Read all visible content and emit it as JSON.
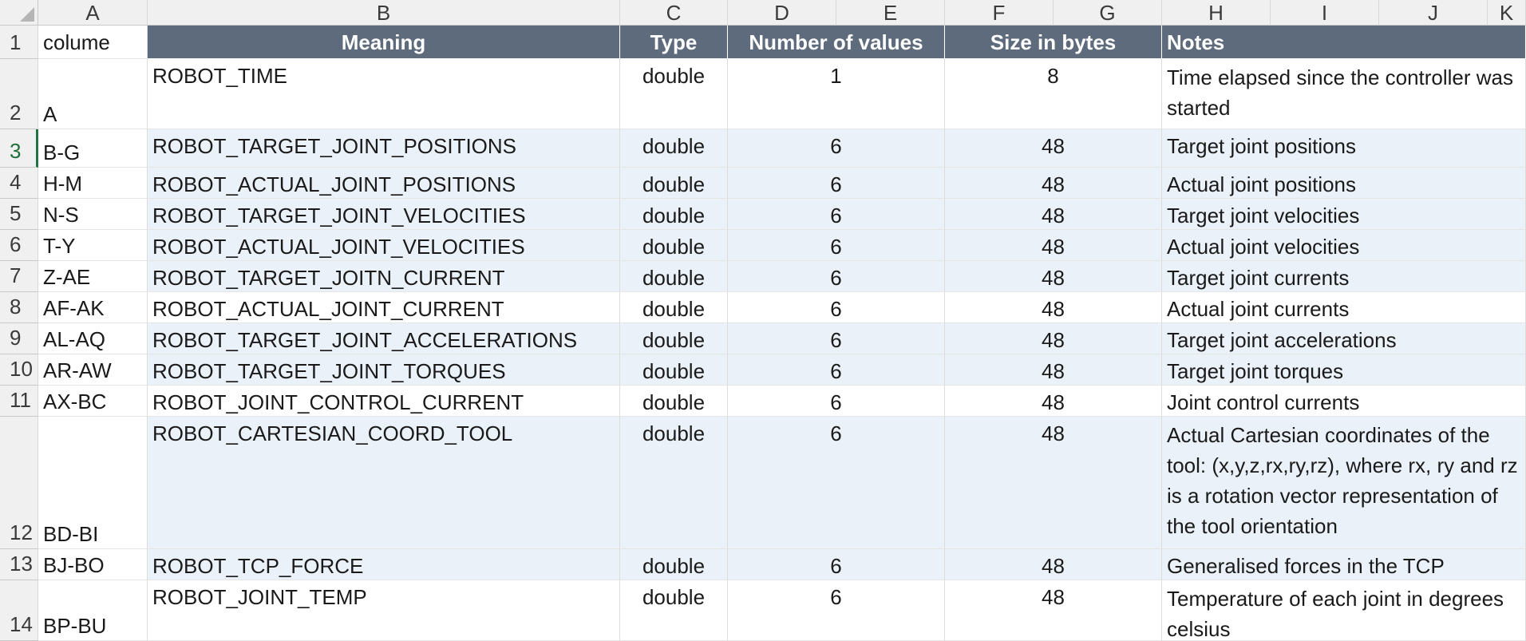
{
  "columns": [
    "A",
    "B",
    "C",
    "D",
    "E",
    "F",
    "G",
    "H",
    "I",
    "J",
    "K"
  ],
  "header": {
    "a": "colume",
    "meaning": "Meaning",
    "type": "Type",
    "count": "Number of values",
    "size": "Size in bytes",
    "notes": "Notes"
  },
  "rows": [
    {
      "num": "2",
      "col": "A",
      "meaning": "ROBOT_TIME",
      "type": "double",
      "count": "1",
      "size": "8",
      "notes": "Time elapsed since the controller was started"
    },
    {
      "num": "3",
      "col": "B-G",
      "meaning": "ROBOT_TARGET_JOINT_POSITIONS",
      "type": "double",
      "count": "6",
      "size": "48",
      "notes": "Target joint positions"
    },
    {
      "num": "4",
      "col": "H-M",
      "meaning": "ROBOT_ACTUAL_JOINT_POSITIONS",
      "type": "double",
      "count": "6",
      "size": "48",
      "notes": "Actual joint positions"
    },
    {
      "num": "5",
      "col": "N-S",
      "meaning": "ROBOT_TARGET_JOINT_VELOCITIES",
      "type": "double",
      "count": "6",
      "size": "48",
      "notes": "Target joint velocities"
    },
    {
      "num": "6",
      "col": "T-Y",
      "meaning": "ROBOT_ACTUAL_JOINT_VELOCITIES",
      "type": "double",
      "count": "6",
      "size": "48",
      "notes": "Actual joint velocities"
    },
    {
      "num": "7",
      "col": "Z-AE",
      "meaning": "ROBOT_TARGET_JOITN_CURRENT",
      "type": "double",
      "count": "6",
      "size": "48",
      "notes": "Target joint currents"
    },
    {
      "num": "8",
      "col": "AF-AK",
      "meaning": "ROBOT_ACTUAL_JOINT_CURRENT",
      "type": "double",
      "count": "6",
      "size": "48",
      "notes": "Actual joint currents"
    },
    {
      "num": "9",
      "col": "AL-AQ",
      "meaning": "ROBOT_TARGET_JOINT_ACCELERATIONS",
      "type": "double",
      "count": "6",
      "size": "48",
      "notes": "Target joint accelerations"
    },
    {
      "num": "10",
      "col": "AR-AW",
      "meaning": "ROBOT_TARGET_JOINT_TORQUES",
      "type": "double",
      "count": "6",
      "size": "48",
      "notes": "Target joint torques"
    },
    {
      "num": "11",
      "col": "AX-BC",
      "meaning": "ROBOT_JOINT_CONTROL_CURRENT",
      "type": "double",
      "count": "6",
      "size": "48",
      "notes": "Joint control currents"
    },
    {
      "num": "12",
      "col": "BD-BI",
      "meaning": "ROBOT_CARTESIAN_COORD_TOOL",
      "type": "double",
      "count": "6",
      "size": "48",
      "notes": "Actual Cartesian coordinates of the tool: (x,y,z,rx,ry,rz), where rx, ry and rz is a rotation vector representation of the tool orientation"
    },
    {
      "num": "13",
      "col": "BJ-BO",
      "meaning": "ROBOT_TCP_FORCE",
      "type": "double",
      "count": "6",
      "size": "48",
      "notes": "Generalised forces in the TCP"
    },
    {
      "num": "14",
      "col": "BP-BU",
      "meaning": "ROBOT_JOINT_TEMP",
      "type": "double",
      "count": "6",
      "size": "48",
      "notes": "Temperature of each joint in degrees celsius"
    }
  ],
  "colors": {
    "header_bg": "#5e6b7d",
    "band_bg": "#eaf1f8",
    "active_row": "#217346"
  }
}
